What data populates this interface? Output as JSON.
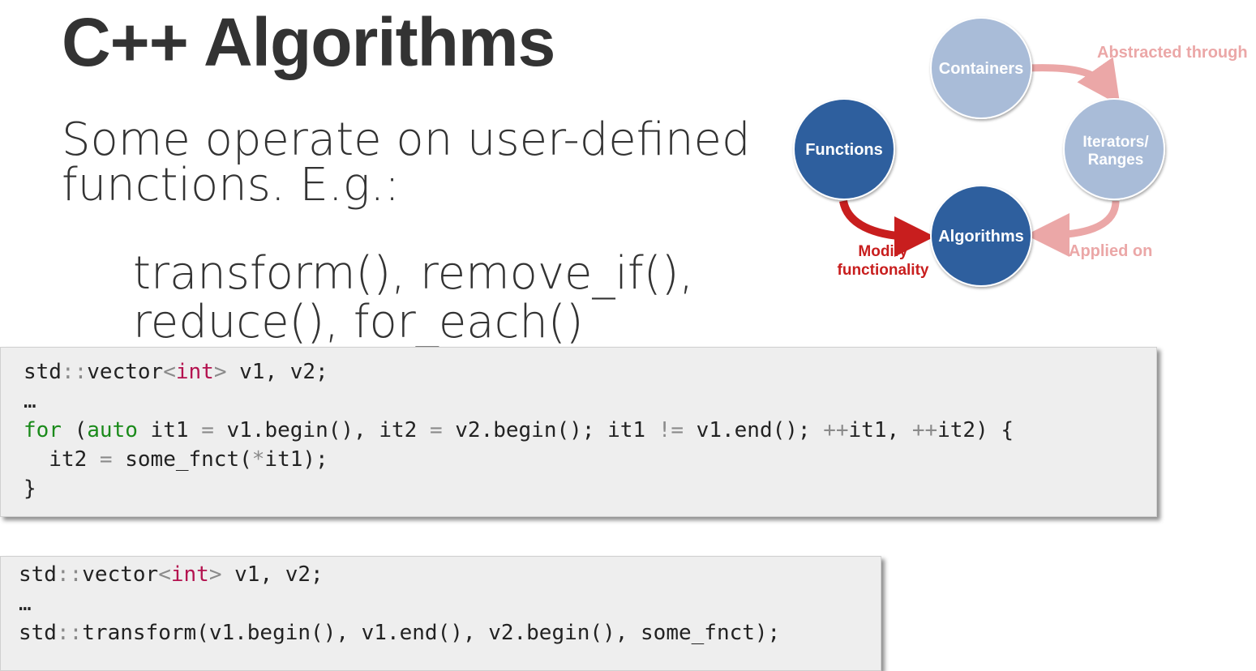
{
  "slide": {
    "title": "C++ Algorithms",
    "body_line1": "Some operate on user-defined",
    "body_line2": "functions. E.g.:",
    "sub_line1": "transform(), remove_if(),",
    "sub_line2": "reduce(), for_each()"
  },
  "diagram": {
    "nodes": {
      "containers": "Containers",
      "iterators_line1": "Iterators/",
      "iterators_line2": "Ranges",
      "functions": "Functions",
      "algorithms": "Algorithms"
    },
    "edges": {
      "abstracted": "Abstracted through",
      "applied": "Applied on",
      "modify_line1": "Modify",
      "modify_line2": "functionality"
    },
    "colors": {
      "light_node": "#a9bcd8",
      "dark_node": "#2f5f9e",
      "light_arrow": "#eba7a7",
      "dark_arrow": "#c81e1e"
    }
  },
  "code1": {
    "line1_a": "std",
    "line1_b": "::",
    "line1_c": "vector",
    "line1_d": "<",
    "line1_e": "int",
    "line1_f": ">",
    "line1_g": " v1, v2;",
    "line2": "…",
    "line3_for": "for",
    "line3_a": " (",
    "line3_auto": "auto",
    "line3_b": " it1 ",
    "line3_eq1": "=",
    "line3_c": " v1.begin(), it2 ",
    "line3_eq2": "=",
    "line3_d": " v2.begin(); it1 ",
    "line3_ne": "!=",
    "line3_e": " v1.end(); ",
    "line3_inc1": "++",
    "line3_f": "it1, ",
    "line3_inc2": "++",
    "line3_g": "it2) {",
    "line4_a": "  it2 ",
    "line4_eq": "=",
    "line4_b": " some_fnct(",
    "line4_star": "*",
    "line4_c": "it1);",
    "line5": "}"
  },
  "code2": {
    "line1_a": "std",
    "line1_b": "::",
    "line1_c": "vector",
    "line1_d": "<",
    "line1_e": "int",
    "line1_f": ">",
    "line1_g": " v1, v2;",
    "line2": "…",
    "line3_a": "std",
    "line3_b": "::",
    "line3_c": "transform(v1.begin(), v1.end(), v2.begin(), some_fnct);"
  }
}
